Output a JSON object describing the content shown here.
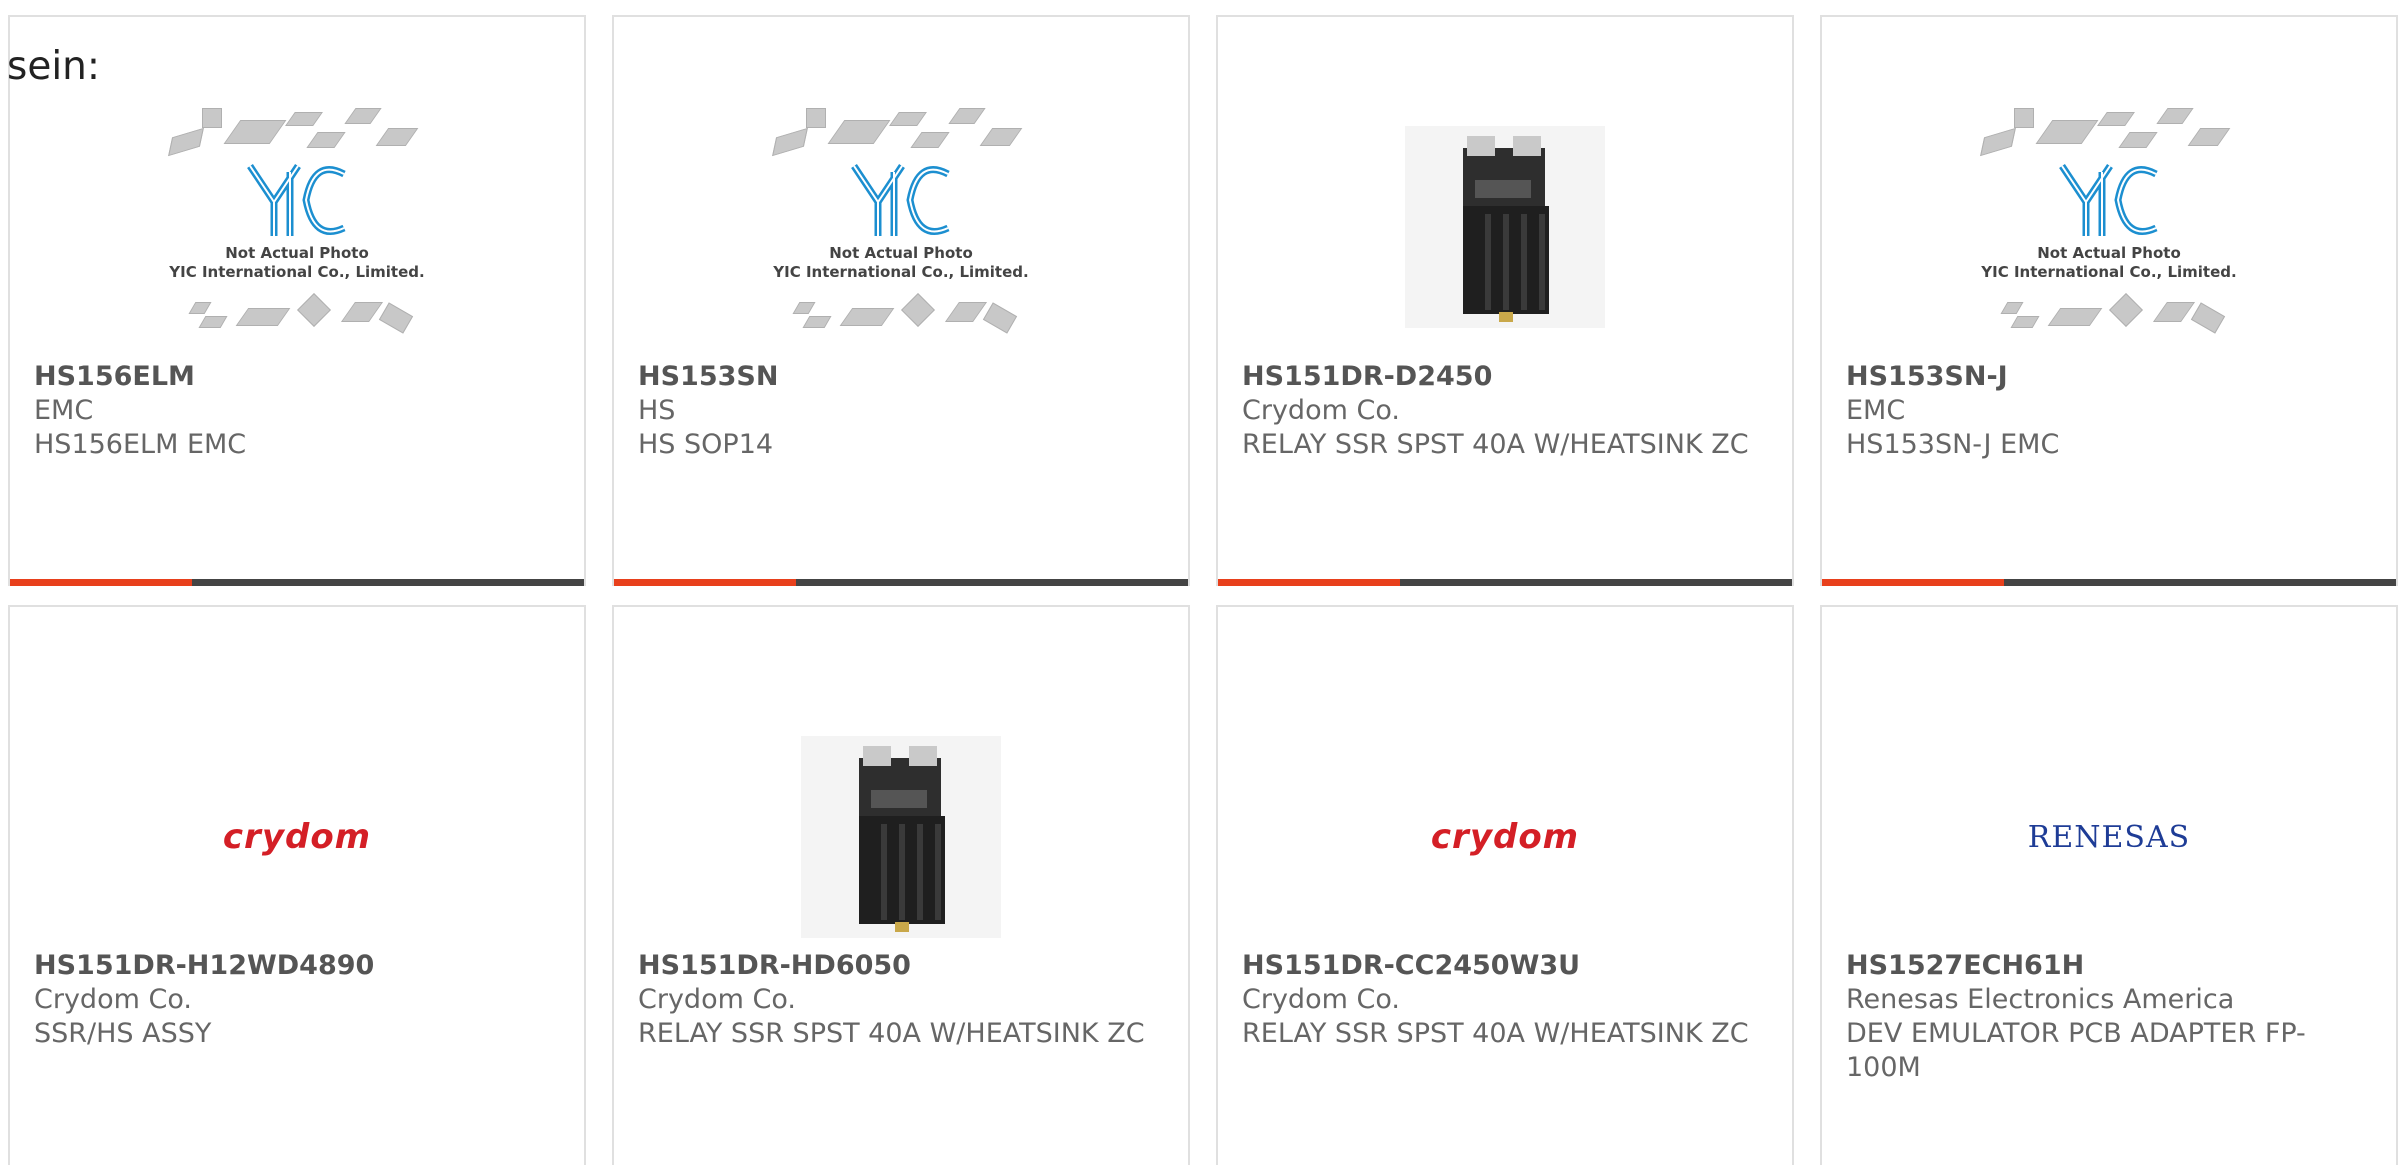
{
  "intro_text": "sein:",
  "accent_color": "#e8401c",
  "bar_color": "#444444",
  "placeholder": {
    "line1": "Not Actual Photo",
    "line2": "YIC International Co., Limited."
  },
  "brands": {
    "crydom": "crydom",
    "renesas": "RENESAS"
  },
  "products": [
    {
      "part": "HS156ELM",
      "manufacturer": "EMC",
      "description": "HS156ELM EMC",
      "image": "yic-placeholder"
    },
    {
      "part": "HS153SN",
      "manufacturer": "HS",
      "description": "HS SOP14",
      "image": "yic-placeholder"
    },
    {
      "part": "HS151DR-D2450",
      "manufacturer": "Crydom Co.",
      "description": "RELAY SSR SPST 40A W/HEATSINK ZC",
      "image": "relay-photo"
    },
    {
      "part": "HS153SN-J",
      "manufacturer": "EMC",
      "description": "HS153SN-J EMC",
      "image": "yic-placeholder"
    },
    {
      "part": "HS151DR-H12WD4890",
      "manufacturer": "Crydom Co.",
      "description": "SSR/HS ASSY",
      "image": "crydom-logo"
    },
    {
      "part": "HS151DR-HD6050",
      "manufacturer": "Crydom Co.",
      "description": "RELAY SSR SPST 40A W/HEATSINK ZC",
      "image": "relay-photo"
    },
    {
      "part": "HS151DR-CC2450W3U",
      "manufacturer": "Crydom Co.",
      "description": "RELAY SSR SPST 40A W/HEATSINK ZC",
      "image": "crydom-logo"
    },
    {
      "part": "HS1527ECH61H",
      "manufacturer": "Renesas Electronics America",
      "description": "DEV EMULATOR PCB ADAPTER FP-100M",
      "image": "renesas-logo"
    }
  ]
}
